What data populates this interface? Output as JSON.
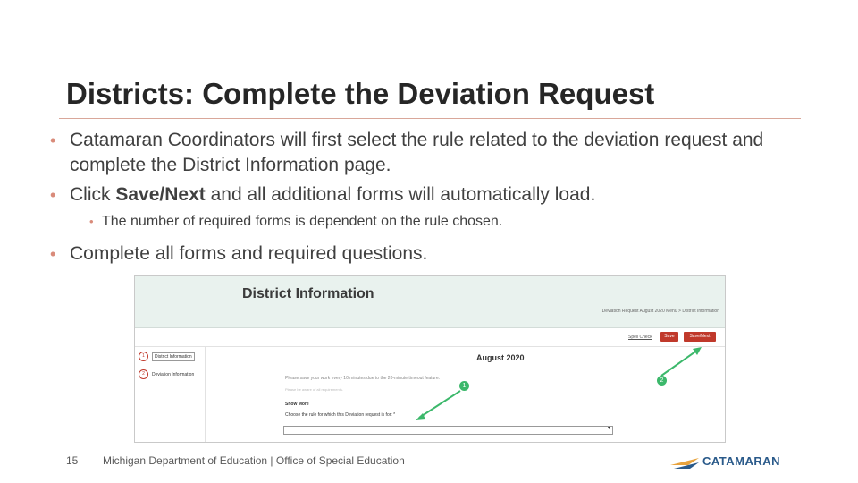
{
  "slide": {
    "title": "Districts: Complete the Deviation Request",
    "bullets": [
      {
        "text": "Catamaran Coordinators will first select the rule related to the deviation request and complete the District Information page."
      },
      {
        "pre": "Click ",
        "bold": "Save/Next",
        "post": " and all additional forms will automatically load."
      },
      {
        "text": "The number of required forms is dependent on the rule chosen."
      },
      {
        "text": "Complete all forms and required questions."
      }
    ],
    "page_number": "15",
    "footer": "Michigan Department of Education | Office of Special Education",
    "logo_text": "CATAMARAN"
  },
  "screenshot": {
    "header_title": "District Information",
    "breadcrumb": "Deviation Request August 2020 Menu > District Information",
    "spell_check": "Spell Check",
    "save_label": "Save",
    "save_next_label": "Save/Next",
    "steps": [
      {
        "num": "1",
        "label": "District Information"
      },
      {
        "num": "2",
        "label": "Deviation Information"
      }
    ],
    "month": "August 2020",
    "notice": "Please save your work every 10 minutes due to the 20-minute timeout feature.",
    "notice_sub": "Please be aware of all requirements.",
    "show_more": "Show More",
    "rule_label": "Choose the rule for which this Deviation request is for: *",
    "callout_1": "1",
    "callout_2": "2"
  },
  "colors": {
    "accent_bullet": "#d98b7a",
    "title_rule": "#d9a79a",
    "button_red": "#c0392b",
    "callout_green": "#3cb86b",
    "header_bg": "#e9f2ee",
    "logo_blue": "#2a5a8a",
    "logo_orange": "#e8a33d"
  }
}
